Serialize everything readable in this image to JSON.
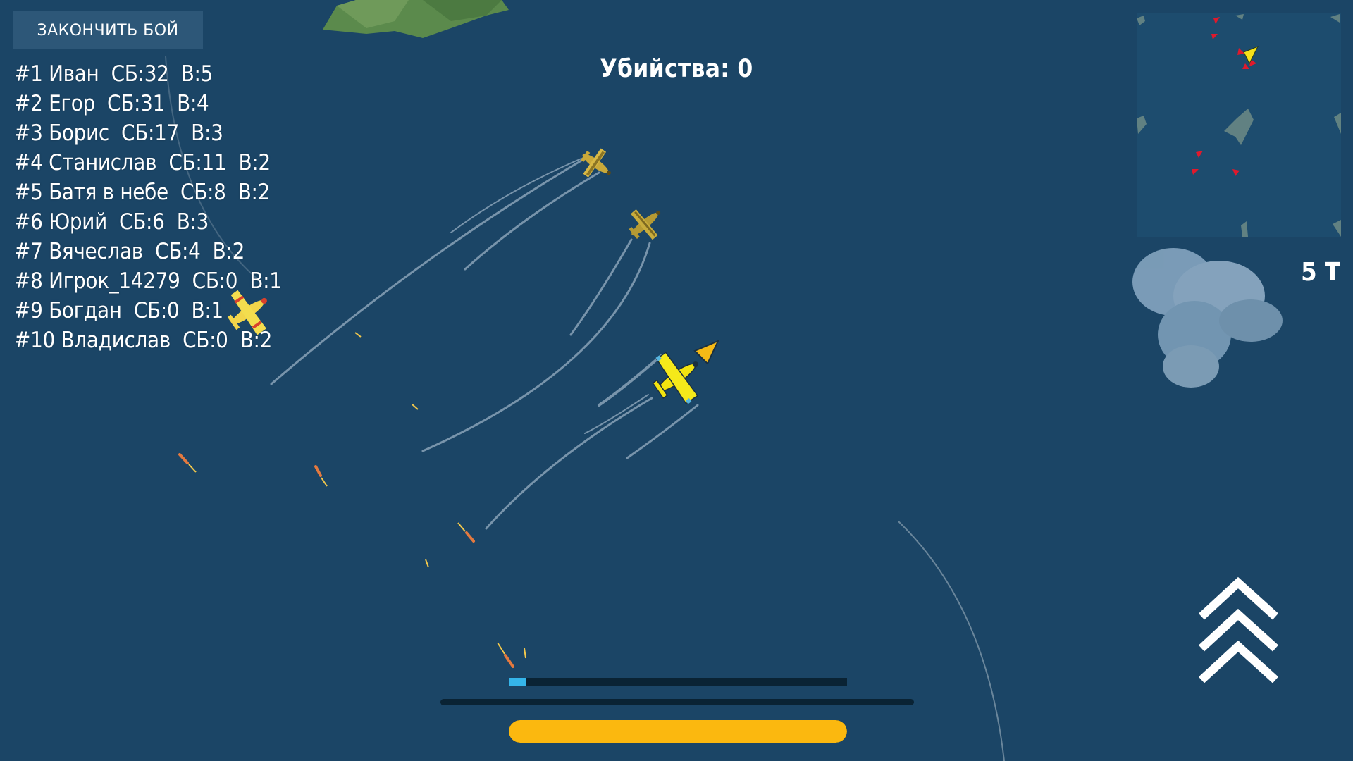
{
  "hud": {
    "end_battle_label": "ЗАКОНЧИТЬ БОЙ",
    "kills_text": "Убийства: 0",
    "side_text": "5 Т"
  },
  "leaderboard": [
    "#1 Иван  СБ:32  В:5",
    "#2 Егор  СБ:31  В:4",
    "#3 Борис  СБ:17  В:3",
    "#4 Станислав  СБ:11  В:2",
    "#5 Батя в небе  СБ:8  В:2",
    "#6 Юрий  СБ:6  В:3",
    "#7 Вячеслав  СБ:4  В:2",
    "#8 Игрок_14279  СБ:0  В:1",
    "#9 Богдан  СБ:0  В:1",
    "#10 Владислав  СБ:0  В:2"
  ],
  "bars": {
    "progress_fraction": 0.05,
    "fuel_fraction": 1.0
  },
  "icons": {
    "boost": "chevron-up-triple-icon",
    "direction": "direction-arrow-icon",
    "player": "player-plane-icon",
    "enemy": "enemy-plane-icon"
  },
  "colors": {
    "sea": "#1b4566",
    "progress": "#35b5ea",
    "fuel": "#fbb80f",
    "player_plane": "#f2e40f",
    "enemy_marker": "#e0192c",
    "player_marker": "#f5e11a"
  }
}
